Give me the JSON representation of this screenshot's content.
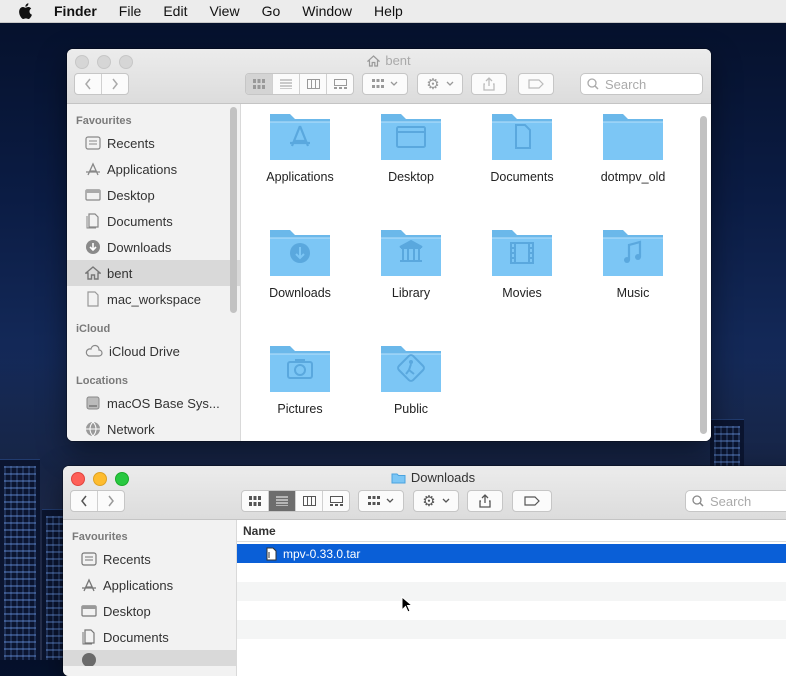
{
  "menubar": {
    "items": [
      "Finder",
      "File",
      "Edit",
      "View",
      "Go",
      "Window",
      "Help"
    ]
  },
  "window_top": {
    "title": "bent",
    "search_placeholder": "Search",
    "sidebar": {
      "favourites_label": "Favourites",
      "favourites": [
        "Recents",
        "Applications",
        "Desktop",
        "Documents",
        "Downloads",
        "bent",
        "mac_workspace"
      ],
      "selected": "bent",
      "icloud_label": "iCloud",
      "icloud": [
        "iCloud Drive"
      ],
      "locations_label": "Locations",
      "locations": [
        "macOS Base Sys...",
        "Network"
      ]
    },
    "folders": [
      "Applications",
      "Desktop",
      "Documents",
      "dotmpv_old",
      "Downloads",
      "Library",
      "Movies",
      "Music",
      "Pictures",
      "Public"
    ]
  },
  "window_bottom": {
    "title": "Downloads",
    "search_placeholder": "Search",
    "sidebar": {
      "favourites_label": "Favourites",
      "favourites": [
        "Recents",
        "Applications",
        "Desktop",
        "Documents"
      ]
    },
    "column_name": "Name",
    "files": [
      "mpv-0.33.0.tar"
    ]
  },
  "colors": {
    "folder": "#7cc6f5",
    "selection": "#0a5fd7",
    "close": "#fe5f57",
    "minimize": "#febc2e",
    "zoom": "#28c840"
  }
}
